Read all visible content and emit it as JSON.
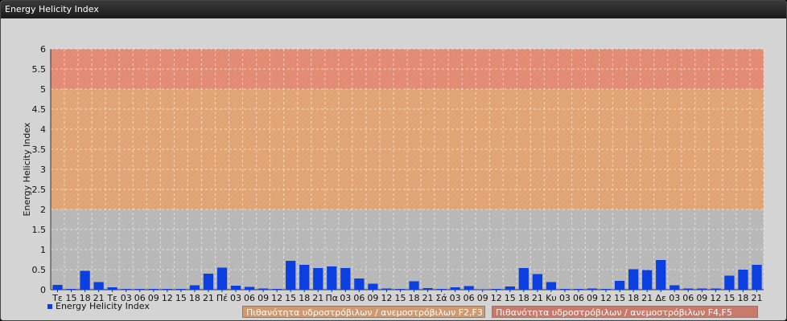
{
  "window": {
    "title": "Energy Helicity Index"
  },
  "colors": {
    "band_high": "#e28a72",
    "band_mid": "#e0a474",
    "band_low": "#b7b7b7",
    "bar": "#0b3fe0",
    "legend_f2f3": "#cf9a72",
    "legend_f4f5": "#c97a6a"
  },
  "legend": {
    "series_label": "Energy Helicity Index",
    "band_f2f3": "Πιθανότητα υδροστρόβιλων / ανεμοστρόβιλων F2,F3",
    "band_f4f5": "Πιθανότητα υδροστρόβιλων / ανεμοστρόβιλων F4,F5"
  },
  "chart_data": {
    "type": "bar",
    "ylabel": "Energy Helicity Index",
    "ylim": [
      0,
      6
    ],
    "yticks": [
      "0",
      "0.5",
      "1",
      "1.5",
      "2",
      "2.5",
      "3",
      "3.5",
      "4",
      "4.5",
      "5",
      "5.5",
      "6"
    ],
    "grid": true,
    "bands": [
      {
        "from": 0,
        "to": 2,
        "color": "#b7b7b7"
      },
      {
        "from": 2,
        "to": 5,
        "color": "#e0a474"
      },
      {
        "from": 5,
        "to": 6,
        "color": "#e28a72"
      }
    ],
    "categories": [
      "Τε",
      "15",
      "18",
      "21",
      "Τε",
      "03",
      "06",
      "09",
      "12",
      "15",
      "18",
      "21",
      "Πέ",
      "03",
      "06",
      "09",
      "12",
      "15",
      "18",
      "21",
      "Πα",
      "03",
      "06",
      "09",
      "12",
      "15",
      "18",
      "21",
      "Σά",
      "03",
      "06",
      "09",
      "12",
      "15",
      "18",
      "21",
      "Κυ",
      "03",
      "06",
      "09",
      "12",
      "15",
      "18",
      "21",
      "Δε",
      "03",
      "06",
      "09",
      "12",
      "15",
      "18",
      "21"
    ],
    "series": [
      {
        "name": "Energy Helicity Index",
        "values": [
          0.12,
          0.02,
          0.47,
          0.19,
          0.06,
          0.02,
          0.02,
          0.02,
          0.02,
          0.02,
          0.11,
          0.4,
          0.55,
          0.1,
          0.07,
          0.03,
          0.02,
          0.72,
          0.62,
          0.54,
          0.58,
          0.54,
          0.28,
          0.15,
          0.03,
          0.02,
          0.21,
          0.04,
          0.02,
          0.06,
          0.09,
          0.01,
          0.02,
          0.08,
          0.54,
          0.39,
          0.19,
          0.02,
          0.02,
          0.03,
          0.02,
          0.22,
          0.51,
          0.49,
          0.74,
          0.11,
          0.03,
          0.03,
          0.03,
          0.35,
          0.5,
          0.62
        ]
      }
    ]
  }
}
